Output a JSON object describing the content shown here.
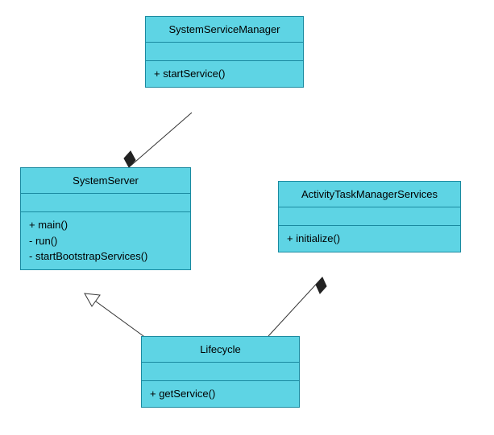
{
  "classes": {
    "systemServiceManager": {
      "name": "SystemServiceManager",
      "methods": [
        "+ startService()"
      ]
    },
    "systemServer": {
      "name": "SystemServer",
      "methods": [
        "+ main()",
        "- run()",
        "- startBootstrapServices()"
      ]
    },
    "activityTaskManagerServices": {
      "name": "ActivityTaskManagerServices",
      "methods": [
        "+ initialize()"
      ]
    },
    "lifecycle": {
      "name": "Lifecycle",
      "methods": [
        "+ getService()"
      ]
    }
  },
  "chart_data": {
    "type": "uml-class-diagram",
    "classes": [
      {
        "name": "SystemServiceManager",
        "attributes": [],
        "methods": [
          {
            "vis": "+",
            "sig": "startService()"
          }
        ]
      },
      {
        "name": "SystemServer",
        "attributes": [],
        "methods": [
          {
            "vis": "+",
            "sig": "main()"
          },
          {
            "vis": "-",
            "sig": "run()"
          },
          {
            "vis": "-",
            "sig": "startBootstrapServices()"
          }
        ]
      },
      {
        "name": "ActivityTaskManagerServices",
        "attributes": [],
        "methods": [
          {
            "vis": "+",
            "sig": "initialize()"
          }
        ]
      },
      {
        "name": "Lifecycle",
        "attributes": [],
        "methods": [
          {
            "vis": "+",
            "sig": "getService()"
          }
        ]
      }
    ],
    "relationships": [
      {
        "from": "SystemServer",
        "to": "SystemServiceManager",
        "type": "composition"
      },
      {
        "from": "ActivityTaskManagerServices",
        "to": "Lifecycle",
        "type": "composition"
      },
      {
        "from": "Lifecycle",
        "to": "SystemServer",
        "type": "generalization"
      }
    ]
  }
}
